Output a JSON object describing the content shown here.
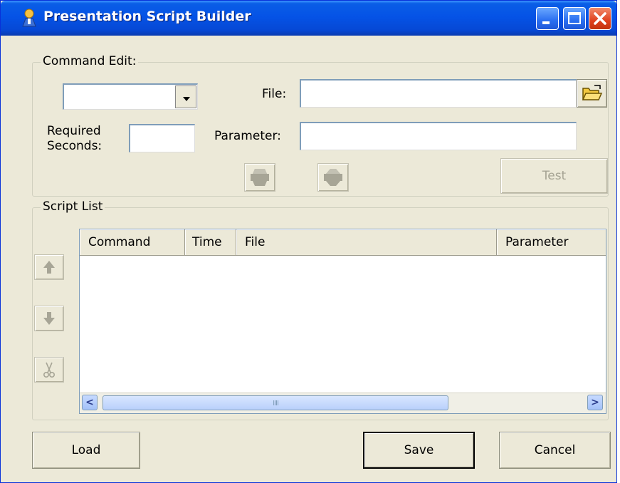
{
  "window": {
    "title": "Presentation Script Builder",
    "title_color": "#ffffff",
    "titlebar_color": "#0553e6"
  },
  "command_edit": {
    "group_label": "Command Edit:",
    "command_select_value": "",
    "file_label": "File:",
    "file_value": "",
    "required_seconds_label_line1": "Required",
    "required_seconds_label_line2": "Seconds:",
    "required_seconds_value": "",
    "parameter_label": "Parameter:",
    "parameter_value": "",
    "browse_icon": "folder-open-icon",
    "test_label": "Test"
  },
  "script_list": {
    "group_label": "Script List",
    "columns": [
      "Command",
      "Time",
      "File",
      "Parameter"
    ],
    "rows": [],
    "scroll_left": "<",
    "scroll_right": ">",
    "grip": "IIII"
  },
  "footer": {
    "load_label": "Load",
    "save_label": "Save",
    "cancel_label": "Cancel"
  }
}
